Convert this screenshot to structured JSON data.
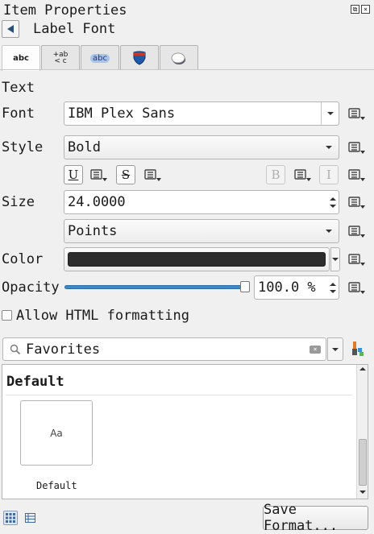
{
  "panel": {
    "title": "Item Properties"
  },
  "header": {
    "label": "Label Font"
  },
  "tabs": [
    {
      "name": "text",
      "icon": "abc"
    },
    {
      "name": "formatting",
      "icon": "+ab<c"
    },
    {
      "name": "buffer",
      "icon": "abc"
    },
    {
      "name": "background",
      "icon": "shield"
    },
    {
      "name": "shadow",
      "icon": "shadow"
    }
  ],
  "text_section": {
    "heading": "Text",
    "font_label": "Font",
    "font_value": "IBM Plex Sans",
    "style_label": "Style",
    "style_value": "Bold",
    "underline": "U",
    "strike": "S",
    "bold": "B",
    "italic": "I",
    "size_label": "Size",
    "size_value": "24.0000",
    "unit_value": "Points",
    "color_label": "Color",
    "color_value": "#2d2d2d",
    "opacity_label": "Opacity",
    "opacity_value": "100.0 %",
    "opacity_fraction": 1.0,
    "html_label": "Allow HTML formatting"
  },
  "styles": {
    "search_value": "Favorites",
    "group_heading": "Default",
    "preview_text": "Aa",
    "preview_name": "Default"
  },
  "footer": {
    "save_label": "Save Format..."
  },
  "colors": {
    "accent": "#3d88c8",
    "data_defined": "#444444"
  }
}
